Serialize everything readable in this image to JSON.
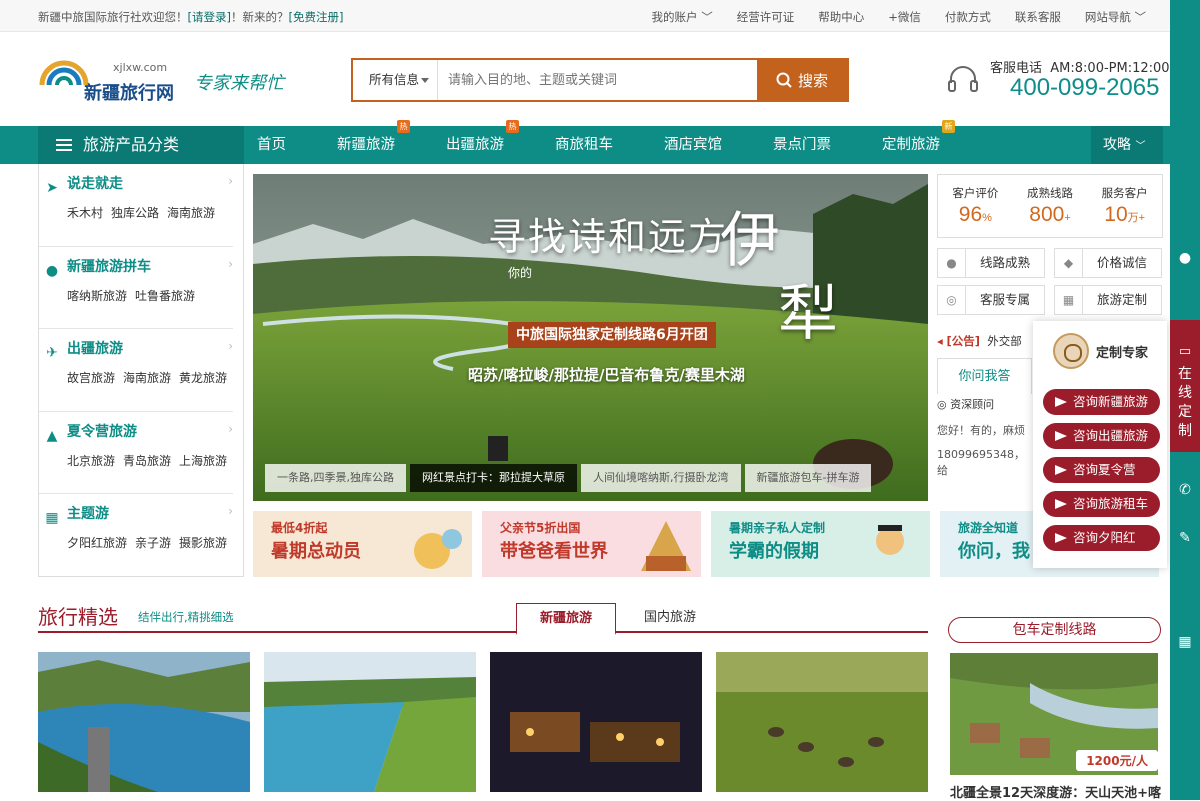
{
  "topbar": {
    "welcome_prefix": "新疆中旅国际旅行社欢迎您！",
    "login": "[请登录]",
    "mid": "！新来的？",
    "register": "[免费注册]",
    "links": [
      "我的账户 ﹀",
      "经营许可证",
      "帮助中心",
      "+微信",
      "付款方式",
      "联系客服",
      "网站导航 ﹀"
    ]
  },
  "logo": {
    "brand": "新疆旅行网",
    "domain": "xjlxw.com",
    "slogan": "专家来帮忙"
  },
  "search": {
    "scope": "所有信息",
    "placeholder": "请输入目的地、主题或关键词",
    "button": "搜索"
  },
  "hotline": {
    "label": "客服电话",
    "hours": "AM:8:00-PM:12:00",
    "number": "400-099-2065"
  },
  "nav": {
    "category": "旅游产品分类",
    "items": [
      {
        "label": "首页",
        "badge": ""
      },
      {
        "label": "新疆旅游",
        "badge": "热"
      },
      {
        "label": "出疆旅游",
        "badge": "热"
      },
      {
        "label": "商旅租车",
        "badge": ""
      },
      {
        "label": "酒店宾馆",
        "badge": ""
      },
      {
        "label": "景点门票",
        "badge": ""
      },
      {
        "label": "定制旅游",
        "badge": "新"
      }
    ],
    "guide": "攻略"
  },
  "sidebar": [
    {
      "title": "说走就走",
      "subs": [
        "禾木村",
        "独库公路",
        "海南旅游"
      ]
    },
    {
      "title": "新疆旅游拼车",
      "subs": [
        "喀纳斯旅游",
        "吐鲁番旅游"
      ]
    },
    {
      "title": "出疆旅游",
      "subs": [
        "故宫旅游",
        "海南旅游",
        "黄龙旅游"
      ]
    },
    {
      "title": "夏令营旅游",
      "subs": [
        "北京旅游",
        "青岛旅游",
        "上海旅游"
      ]
    },
    {
      "title": "主题游",
      "subs": [
        "夕阳红旅游",
        "亲子游",
        "摄影旅游"
      ]
    }
  ],
  "banner": {
    "headline": "寻找诗和远方",
    "small": "你的",
    "big1": "伊",
    "big2": "犁",
    "promo": "中旅国际独家定制线路6月开团",
    "route": "昭苏/喀拉峻/那拉提/巴音布鲁克/赛里木湖",
    "tabs": [
      "一条路,四季景,独库公路",
      "网红景点打卡：那拉提大草原",
      "人间仙境喀纳斯,行摄卧龙湾",
      "新疆旅游包车-拼车游"
    ]
  },
  "promos": [
    {
      "a": "最低4折起",
      "b": "暑期总动员",
      "bg": "#f6e8d4",
      "c": "#c0392b"
    },
    {
      "a": "父亲节5折出国",
      "b": "带爸爸看世界",
      "bg": "#f9dde1",
      "c": "#c0392b"
    },
    {
      "a": "暑期亲子私人定制",
      "b": "学霸的假期",
      "bg": "#d8efe8",
      "c": "#0e8d86"
    },
    {
      "a": "旅游全知道",
      "b": "你问，我",
      "bg": "#e3f0f4",
      "c": "#0e8d86"
    }
  ],
  "stats": [
    {
      "label": "客户评价",
      "value": "96",
      "unit": "%"
    },
    {
      "label": "成熟线路",
      "value": "800",
      "unit": "+"
    },
    {
      "label": "服务客户",
      "value": "10",
      "unit": "万+"
    }
  ],
  "features": [
    "线路成熟",
    "价格诚信",
    "客服专属",
    "旅游定制"
  ],
  "notice": {
    "tag": "[公告]",
    "text": "外交部"
  },
  "ask": {
    "tab": "你问我答",
    "line1": "资深顾问",
    "line2": "您好！有的，麻烦",
    "line3": "18099695348，给"
  },
  "consult": {
    "title": "定制专家",
    "buttons": [
      "咨询新疆旅游",
      "咨询出疆旅游",
      "咨询夏令营",
      "咨询旅游租车",
      "咨询夕阳红"
    ]
  },
  "rail": {
    "online": "在线定制"
  },
  "section": {
    "title": "旅行精选",
    "sub": "结伴出行,精挑细选",
    "tab_active": "新疆旅游",
    "tab_other": "国内旅游"
  },
  "right_section": {
    "title": "包车定制线路",
    "price": "1200元/人",
    "card_title": "北疆全景12天深度游：天山天池+喀"
  }
}
